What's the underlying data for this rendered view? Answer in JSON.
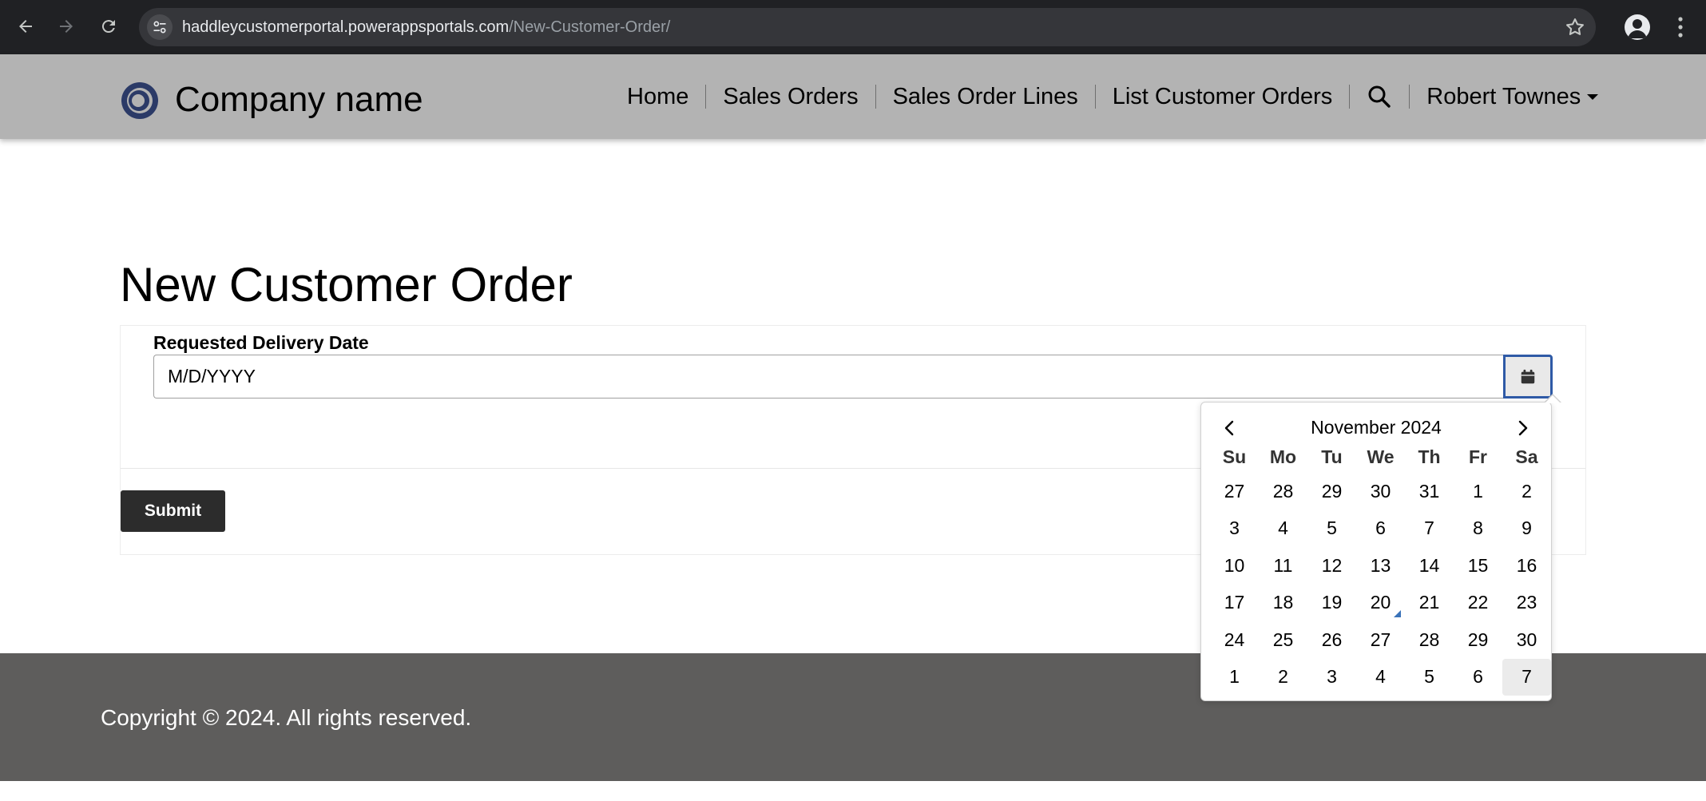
{
  "browser": {
    "url_host": "haddleycustomerportal.powerappsportals.com",
    "url_path": "/New-Customer-Order/"
  },
  "header": {
    "brand": "Company name",
    "nav": [
      "Home",
      "Sales Orders",
      "Sales Order Lines",
      "List Customer Orders"
    ],
    "user": "Robert Townes"
  },
  "page": {
    "title": "New Customer Order"
  },
  "form": {
    "date_label": "Requested Delivery Date",
    "date_value": "",
    "date_placeholder": "M/D/YYYY",
    "submit_label": "Submit"
  },
  "datepicker": {
    "month_label": "November 2024",
    "weekdays": [
      "Su",
      "Mo",
      "Tu",
      "We",
      "Th",
      "Fr",
      "Sa"
    ],
    "weeks": [
      [
        "27",
        "28",
        "29",
        "30",
        "31",
        "1",
        "2"
      ],
      [
        "3",
        "4",
        "5",
        "6",
        "7",
        "8",
        "9"
      ],
      [
        "10",
        "11",
        "12",
        "13",
        "14",
        "15",
        "16"
      ],
      [
        "17",
        "18",
        "19",
        "20",
        "21",
        "22",
        "23"
      ],
      [
        "24",
        "25",
        "26",
        "27",
        "28",
        "29",
        "30"
      ],
      [
        "1",
        "2",
        "3",
        "4",
        "5",
        "6",
        "7"
      ]
    ],
    "today_cell": {
      "week": 3,
      "day": 3
    },
    "selected_cell": {
      "week": 5,
      "day": 6
    },
    "today_marker_color": "#3b73b9"
  },
  "footer": {
    "copyright": "Copyright © 2024. All rights reserved."
  },
  "colors": {
    "header_bg": "#b3b3b3",
    "footer_bg": "#5e5d5c",
    "submit_bg": "#2c2c2c",
    "focus_border": "#2f5aa6"
  },
  "icons": [
    "back-arrow-icon",
    "forward-arrow-icon",
    "reload-icon",
    "site-settings-icon",
    "bookmark-star-icon",
    "profile-icon",
    "menu-kebab-icon",
    "company-logo-icon",
    "search-icon",
    "chevron-down-icon",
    "calendar-icon",
    "chevron-left-icon",
    "chevron-right-icon"
  ]
}
